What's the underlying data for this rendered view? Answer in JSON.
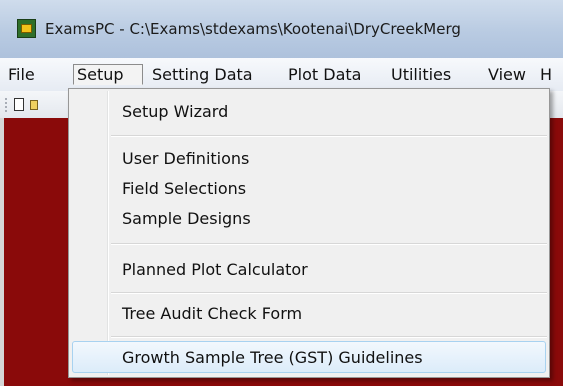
{
  "window": {
    "title": "ExamsPC - C:\\Exams\\stdexams\\Kootenai\\DryCreekMerg"
  },
  "menubar": {
    "items": [
      {
        "label": "File"
      },
      {
        "label": "Setup"
      },
      {
        "label": "Setting Data"
      },
      {
        "label": "Plot Data"
      },
      {
        "label": "Utilities"
      },
      {
        "label": "View"
      },
      {
        "label": "H"
      }
    ],
    "open_menu": "Setup"
  },
  "setup_menu": {
    "groups": [
      [
        "Setup Wizard"
      ],
      [
        "User Definitions",
        "Field Selections",
        "Sample Designs"
      ],
      [
        "Planned Plot Calculator"
      ],
      [
        "Tree Audit Check Form"
      ],
      [
        "Growth Sample Tree (GST) Guidelines"
      ]
    ],
    "items": {
      "setup_wizard": "Setup Wizard",
      "user_definitions": "User Definitions",
      "field_selections": "Field Selections",
      "sample_designs": "Sample Designs",
      "planned_plot_calculator": "Planned Plot Calculator",
      "tree_audit_check_form": "Tree Audit Check Form",
      "gst_guidelines": "Growth Sample Tree (GST) Guidelines"
    },
    "highlighted": "Growth Sample Tree (GST) Guidelines"
  },
  "colors": {
    "workarea": "#8a0a0a",
    "highlight_border": "#a8d2f0",
    "menu_background": "#f0f0f0"
  }
}
